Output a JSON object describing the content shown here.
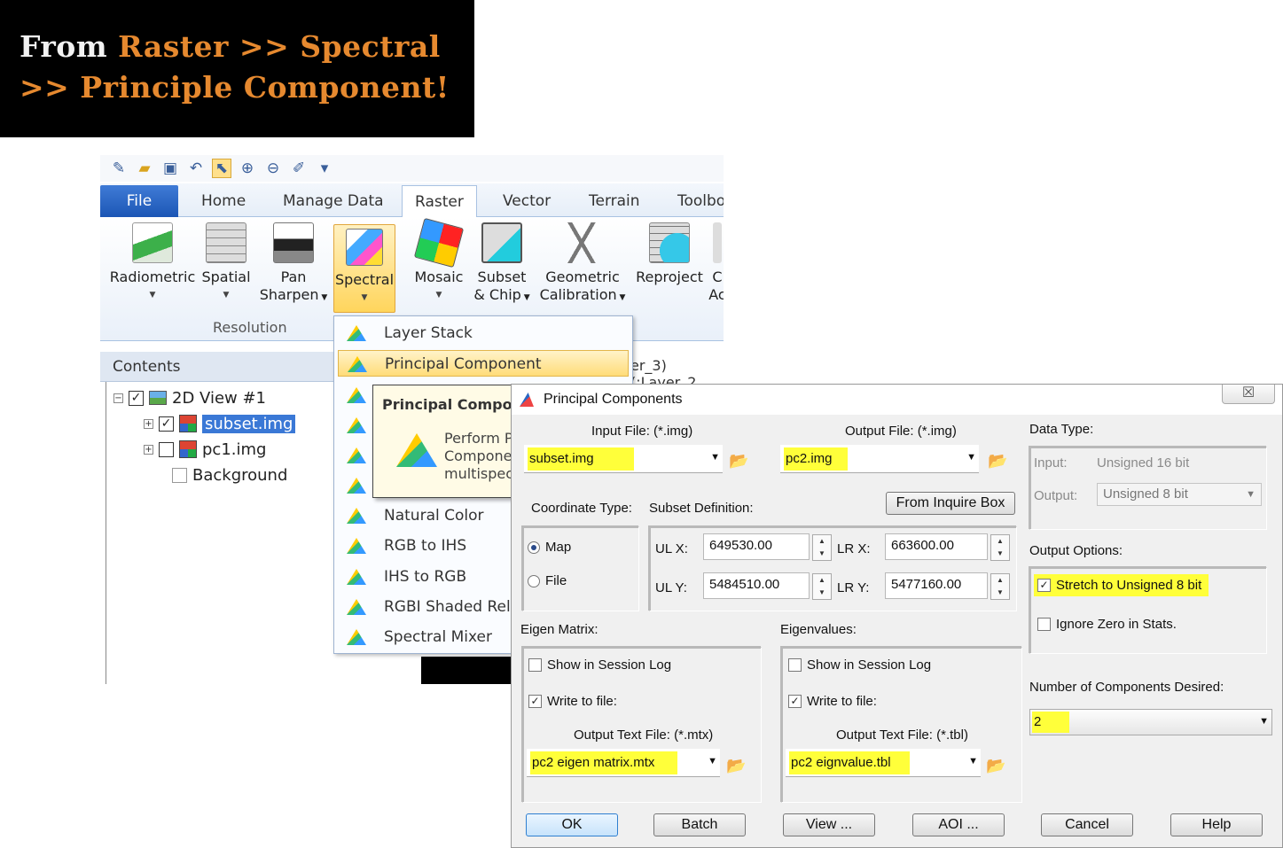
{
  "banner": {
    "line1_white": "From",
    "line1_orange": "Raster >> Spectral",
    "line2_orange": ">> Principle Component!"
  },
  "ribbon": {
    "tabs": [
      "File",
      "Home",
      "Manage Data",
      "Raster",
      "Vector",
      "Terrain",
      "Toolbo"
    ],
    "active_tab": "Raster",
    "buttons": {
      "radiometric": "Radiometric",
      "spatial": "Spatial",
      "pan_sharpen_1": "Pan",
      "pan_sharpen_2": "Sharpen",
      "spectral": "Spectral",
      "mosaic": "Mosaic",
      "subset_1": "Subset",
      "subset_2": "& Chip",
      "geometric_1": "Geometric",
      "geometric_2": "Calibration",
      "reproject": "Reproject",
      "cut_1": "C",
      "cut_2": "Ac"
    },
    "group_label": "Resolution"
  },
  "contents": {
    "header": "Contents",
    "view_label": "2D View #1",
    "layers": [
      "subset.img",
      "pc1.img",
      "Background"
    ],
    "breadcrumb": "er_3)(:Layer_2"
  },
  "spectral_menu": {
    "items": [
      "Layer Stack",
      "Principal Component",
      "Natural Color",
      "RGB to IHS",
      "IHS to RGB",
      "RGBI Shaded Relie",
      "Spectral Mixer"
    ],
    "tooltip_title": "Principal Compon",
    "tooltip_body": "Perform P\nCompone\nmultispec"
  },
  "dialog": {
    "title": "Principal Components",
    "close_glyph": "☒",
    "input_file_label": "Input File: (*.img)",
    "input_file_value": "subset.img",
    "output_file_label": "Output File: (*.img)",
    "output_file_value": "pc2.img",
    "coord_type_label": "Coordinate Type:",
    "coord_options": [
      "Map",
      "File"
    ],
    "coord_selected": "Map",
    "subset_def_label": "Subset Definition:",
    "from_inquire_box": "From Inquire Box",
    "ulx_label": "UL X:",
    "ulx_value": "649530.00",
    "uly_label": "UL Y:",
    "uly_value": "5484510.00",
    "lrx_label": "LR X:",
    "lrx_value": "663600.00",
    "lry_label": "LR Y:",
    "lry_value": "5477160.00",
    "data_type_label": "Data Type:",
    "input_label": "Input:",
    "input_type_value": "Unsigned 16 bit",
    "output_label": "Output:",
    "output_type_value": "Unsigned 8 bit",
    "output_options_label": "Output Options:",
    "stretch_label": "Stretch to Unsigned 8 bit",
    "stretch_checked": true,
    "ignore_zero_label": "Ignore Zero in Stats.",
    "ignore_zero_checked": false,
    "num_components_label": "Number of Components Desired:",
    "num_components_value": "2",
    "eigen_matrix_label": "Eigen Matrix:",
    "eigenvalues_label": "Eigenvalues:",
    "show_session_log": "Show in Session Log",
    "write_to_file": "Write to file:",
    "matrix_output_label": "Output Text File: (*.mtx)",
    "matrix_output_value": "pc2 eigen matrix.mtx",
    "eigval_output_label": "Output Text File: (*.tbl)",
    "eigval_output_value": "pc2 eignvalue.tbl",
    "buttons": {
      "ok": "OK",
      "batch": "Batch",
      "view": "View ...",
      "aoi": "AOI ...",
      "cancel": "Cancel",
      "help": "Help"
    }
  },
  "colors": {
    "banner_orange": "#e6892f",
    "highlight_yellow": "#ffff3a",
    "file_tab_blue": "#1c56b5",
    "selection_blue": "#3a78d6"
  }
}
